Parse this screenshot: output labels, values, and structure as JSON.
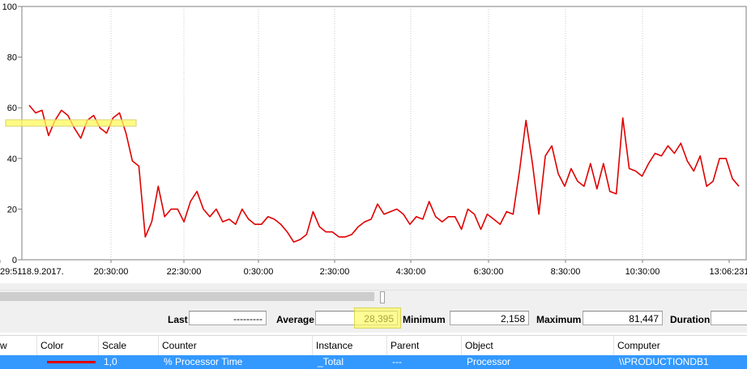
{
  "chart_data": {
    "type": "line",
    "y_range": [
      0,
      100
    ],
    "y_ticks": [
      "100",
      "80",
      "60",
      "40",
      "20",
      "0"
    ],
    "x_tick_labels": [
      "29:5118.9.2017.",
      "20:30:00",
      "22:30:00",
      "0:30:00",
      "2:30:00",
      "4:30:00",
      "6:30:00",
      "8:30:00",
      "10:30:00",
      "13:06:231"
    ],
    "grid": "vertical dotted",
    "series": [
      {
        "color": "#e00000",
        "values": [
          61,
          58,
          59,
          49,
          55,
          59,
          57,
          52,
          48,
          55,
          57,
          52,
          50,
          56,
          58,
          50,
          39,
          37,
          9,
          15,
          29,
          17,
          20,
          20,
          15,
          23,
          27,
          20,
          17,
          20,
          15,
          16,
          14,
          20,
          16,
          14,
          14,
          17,
          16,
          14,
          11,
          7,
          8,
          10,
          19,
          13,
          11,
          11,
          9,
          9,
          10,
          13,
          15,
          16,
          22,
          18,
          19,
          20,
          18,
          14,
          17,
          16,
          23,
          17,
          15,
          17,
          17,
          12,
          20,
          18,
          12,
          18,
          16,
          14,
          19,
          18,
          35,
          55,
          38,
          18,
          41,
          45,
          34,
          29,
          36,
          31,
          29,
          38,
          28,
          38,
          27,
          26,
          56,
          36,
          35,
          33,
          38,
          42,
          41,
          45,
          42,
          46,
          39,
          35,
          41,
          29,
          31,
          40,
          40,
          32,
          29
        ]
      }
    ]
  },
  "stats": {
    "last_label": "Last",
    "last_value": "---------",
    "average_label": "Average",
    "average_value": "28,395",
    "minimum_label": "Minimum",
    "minimum_value": "2,158",
    "maximum_label": "Maximum",
    "maximum_value": "81,447",
    "duration_label": "Duration"
  },
  "counter_grid": {
    "headers": {
      "show": "w",
      "color": "Color",
      "scale": "Scale",
      "counter": "Counter",
      "instance": "Instance",
      "parent": "Parent",
      "object": "Object",
      "computer": "Computer"
    },
    "row": {
      "scale": "1,0",
      "counter": "% Processor Time",
      "instance": "_Total",
      "parent": "---",
      "object": "Processor",
      "computer": "\\\\PRODUCTIONDB1",
      "line_color": "#e00000"
    }
  },
  "colors": {
    "series": "#e00000",
    "selection": "#3399ff",
    "highlight": "#fffa5a"
  }
}
